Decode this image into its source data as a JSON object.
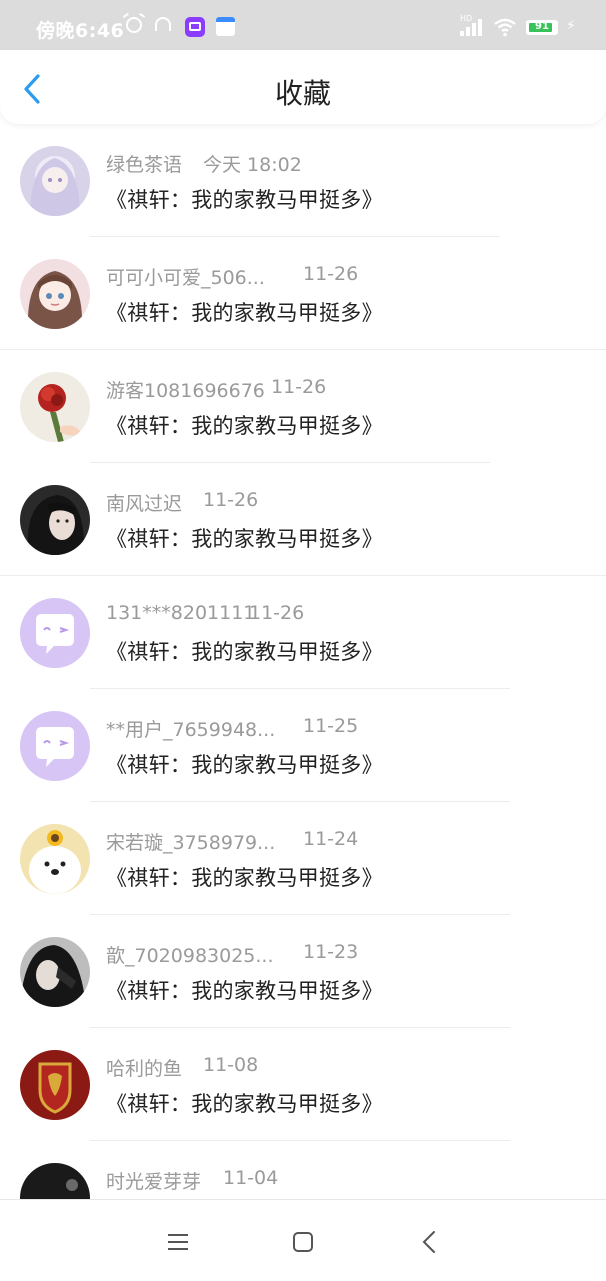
{
  "status_bar": {
    "time": "傍晚6:46",
    "battery": "91",
    "icons": [
      "alarm-icon",
      "headset-icon",
      "app-badge-icon",
      "calendar-icon",
      "signal-icon",
      "wifi-icon",
      "battery-icon",
      "charging-icon"
    ],
    "battery_fill_fraction": 0.91
  },
  "header": {
    "title": "收藏",
    "back_icon": "chevron-left-icon",
    "accent": "#2d9cf0"
  },
  "favorites": [
    {
      "user": "绿色茶语",
      "date": "今天 18:02",
      "book": "《祺轩：我的家教马甲挺多》",
      "avatar": "anime-girl-white-hair"
    },
    {
      "user": "可可小可爱_506...",
      "date": "11-26",
      "book": "《祺轩：我的家教马甲挺多》",
      "avatar": "anime-girl-brown-hair"
    },
    {
      "user": "游客1081696676",
      "date": "11-26",
      "book": "《祺轩：我的家教马甲挺多》",
      "avatar": "red-rose"
    },
    {
      "user": "南风过迟",
      "date": "11-26",
      "book": "《祺轩：我的家教马甲挺多》",
      "avatar": "dark-portrait"
    },
    {
      "user": "131***8201111",
      "date": "11-26",
      "book": "《祺轩：我的家教马甲挺多》",
      "avatar": "default-purple-bubble"
    },
    {
      "user": "**用户_7659948...",
      "date": "11-25",
      "book": "《祺轩：我的家教马甲挺多》",
      "avatar": "default-purple-bubble"
    },
    {
      "user": "宋若璇_3758979...",
      "date": "11-24",
      "book": "《祺轩：我的家教马甲挺多》",
      "avatar": "white-dog-sunflower"
    },
    {
      "user": "歆_7020983025...",
      "date": "11-23",
      "book": "《祺轩：我的家教马甲挺多》",
      "avatar": "dark-portrait"
    },
    {
      "user": "哈利的鱼",
      "date": "11-08",
      "book": "《祺轩：我的家教马甲挺多》",
      "avatar": "red-crest"
    },
    {
      "user": "时光爱芽芽",
      "date": "11-04",
      "book": "",
      "avatar": "dark-portrait"
    }
  ],
  "bottom_nav": {
    "icons": [
      "menu-icon",
      "home-square-icon",
      "back-chevron-icon"
    ]
  }
}
